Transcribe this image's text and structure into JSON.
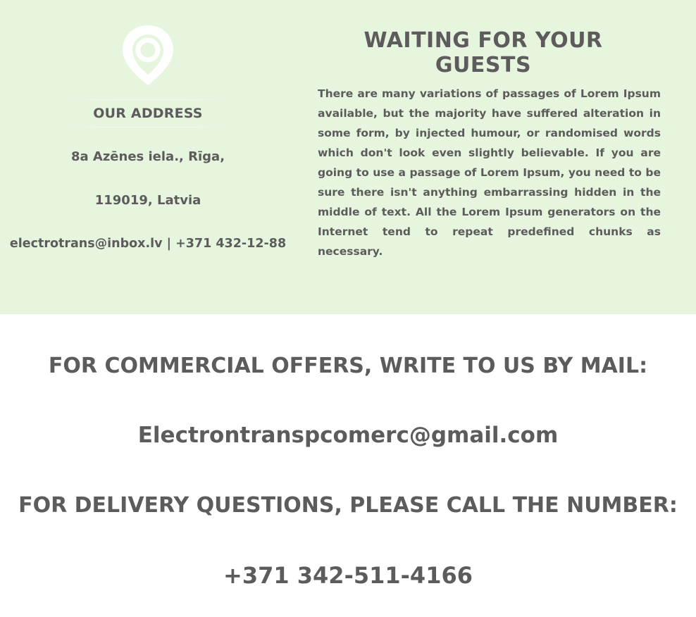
{
  "icons": {
    "location": "map-pin-icon"
  },
  "colors": {
    "top_background": "#e5f5de",
    "text": "#5d5b5b",
    "icon": "#ffffff"
  },
  "address": {
    "title": "OUR ADDRESS",
    "street": "8a Azēnes iela., Rīga,",
    "postal": "119019, Latvia",
    "contacts": "electrotrans@inbox.lv | +371 432-12-88"
  },
  "guests": {
    "heading": "WAITING FOR YOUR GUESTS",
    "text": "There are many variations of passages of Lorem Ipsum available, but the majority have suffered alteration in some form, by injected humour, or randomised words which don't look even slightly believable. If you are going to use a passage of Lorem Ipsum, you need to be sure there isn't anything embarrassing hidden in the middle of text. All the Lorem Ipsum generators on the Internet tend to repeat predefined chunks as necessary."
  },
  "commercial": {
    "label": "FOR COMMERCIAL OFFERS, WRITE TO US BY MAIL:",
    "email": "Electrontranspcomerc@gmail.com"
  },
  "delivery": {
    "label": "FOR DELIVERY QUESTIONS, PLEASE CALL THE NUMBER:",
    "phone": "+371 342-511-4166"
  }
}
